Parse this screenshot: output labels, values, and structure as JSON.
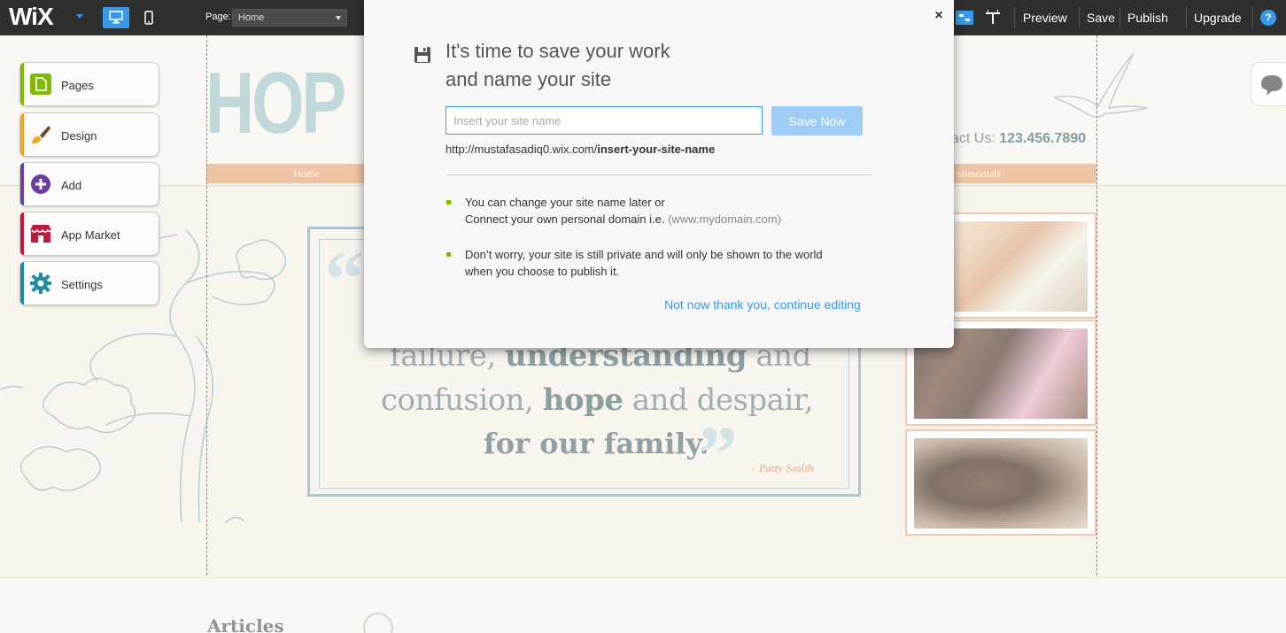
{
  "topbar": {
    "logo": "WiX",
    "page_label": "Page:",
    "page_value": "Home",
    "nav": [
      "Preview",
      "Save",
      "Publish",
      "Upgrade"
    ],
    "help": "?"
  },
  "sidebar": {
    "items": [
      {
        "label": "Pages",
        "color": "#7fb900"
      },
      {
        "label": "Design",
        "color": "#f0a71e"
      },
      {
        "label": "Add",
        "color": "#6b3fa0"
      },
      {
        "label": "App Market",
        "color": "#c2193f"
      },
      {
        "label": "Settings",
        "color": "#1e8ba3"
      }
    ]
  },
  "site": {
    "logo_text": "HOP",
    "contact_label": "act Us: ",
    "contact_phone": "123.456.7890",
    "menu_home": "Home",
    "menu_testimonials": "stimonials",
    "quote_line1_a": "failure, ",
    "quote_line1_b": "understanding",
    "quote_line1_c": " and",
    "quote_line2_a": "confusion, ",
    "quote_line2_b": "hope",
    "quote_line2_c": " and despair,",
    "quote_line3": "for our family.",
    "quote_author": "- Patty Smith",
    "articles": "Articles"
  },
  "modal": {
    "close": "×",
    "title_line1": "It's time to save your work",
    "title_line2": "and name your site",
    "input_placeholder": "Insert your site name",
    "input_value": "",
    "save_button": "Save Now",
    "url_prefix": "http://mustafasadiq0.wix.com/",
    "url_slug": "insert-your-site-name",
    "note1_line1": "You can change your site name later or",
    "note1_line2_a": "Connect your own personal domain i.e. ",
    "note1_line2_b": "(www.mydomain.com)",
    "note2_line1": "Don’t worry, your site is still private and will only be shown to the world",
    "note2_line2": "when you choose to publish it.",
    "continue": "Not now thank you, continue editing"
  },
  "colors": {
    "accent": "#3899ec",
    "bullet": "#7fb900",
    "menu_bar": "#e6a574",
    "teal": "#7fa9b3"
  }
}
